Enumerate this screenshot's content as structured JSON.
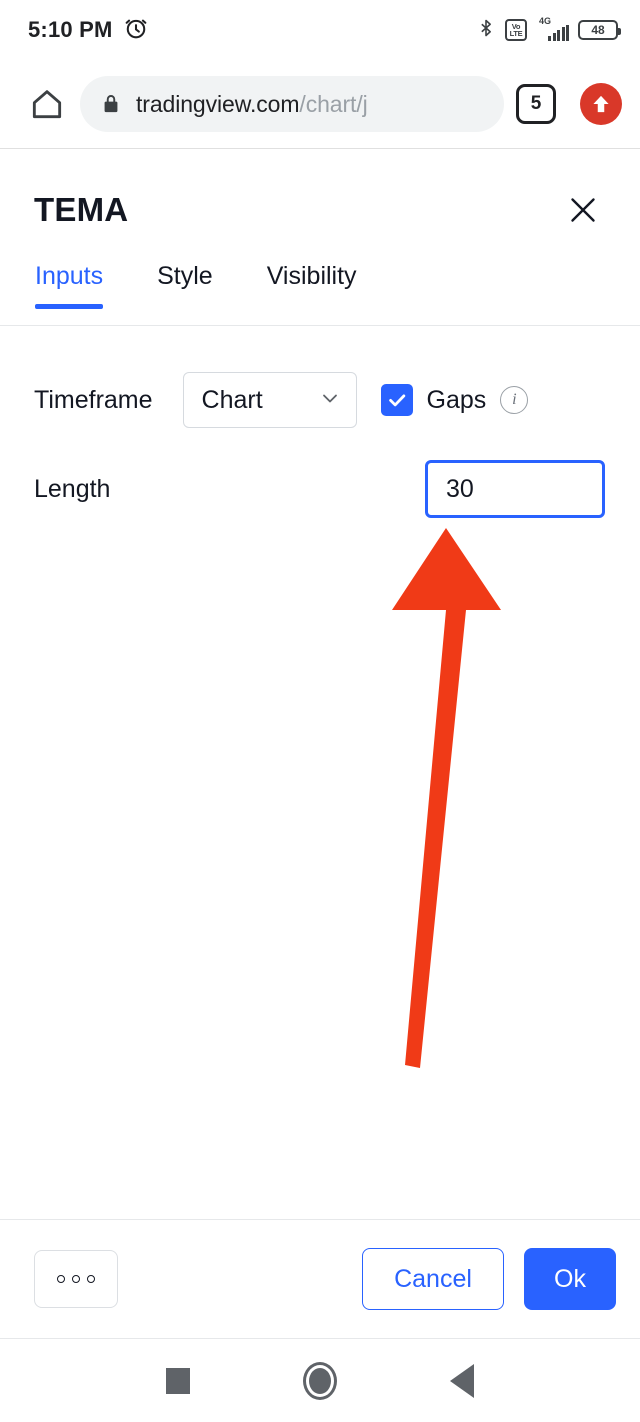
{
  "status_bar": {
    "time": "5:10 PM",
    "alarm_icon": "alarm-clock-icon",
    "bluetooth_icon": "bluetooth-icon",
    "volte_top": "Vo",
    "volte_bottom": "LTE",
    "network_type": "4G",
    "signal_icon": "signal-bars-icon",
    "battery_level": "48"
  },
  "browser": {
    "home_icon": "home-icon",
    "lock_icon": "lock-icon",
    "url_main": "tradingview.com",
    "url_path": "/chart/j",
    "tab_count": "5",
    "update_icon": "update-arrow-icon"
  },
  "dialog": {
    "title": "TEMA",
    "close_icon": "close-icon",
    "tabs": [
      {
        "label": "Inputs",
        "active": true
      },
      {
        "label": "Style",
        "active": false
      },
      {
        "label": "Visibility",
        "active": false
      }
    ],
    "fields": {
      "timeframe": {
        "label": "Timeframe",
        "select_value": "Chart",
        "chevron_icon": "chevron-down-icon",
        "gaps_label": "Gaps",
        "gaps_checked": true,
        "info_icon": "info-icon",
        "info_glyph": "i"
      },
      "length": {
        "label": "Length",
        "value": "30"
      }
    },
    "footer": {
      "more_icon": "more-options-icon",
      "cancel_label": "Cancel",
      "ok_label": "Ok"
    }
  },
  "annotation": {
    "arrow_color": "#f03a17",
    "arrow_icon": "red-up-arrow-annotation",
    "points_to": "Length"
  },
  "nav_bar": {
    "recents_icon": "recents-square-icon",
    "home_icon": "home-circle-icon",
    "back_icon": "back-triangle-icon"
  },
  "colors": {
    "accent_blue": "#2962ff",
    "annotation_red": "#f03a17",
    "text_dark": "#131722",
    "omnibox_bg": "#f1f3f4"
  }
}
